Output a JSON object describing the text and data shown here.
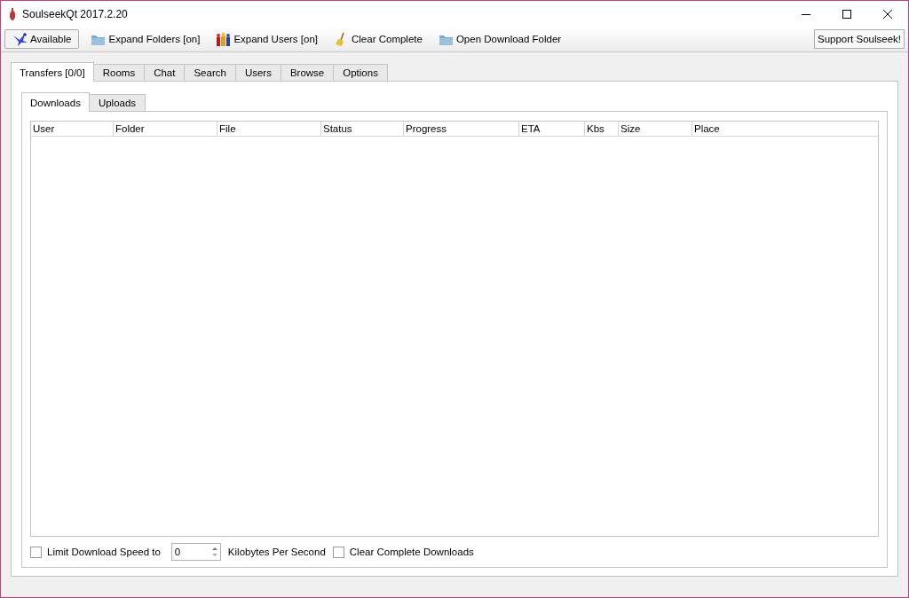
{
  "window": {
    "title": "SoulseekQt 2017.2.20"
  },
  "toolbar": {
    "buttons": [
      {
        "label": "Available",
        "kind": "status"
      },
      {
        "label": "Expand Folders [on]",
        "kind": "folder"
      },
      {
        "label": "Expand Users [on]",
        "kind": "users"
      },
      {
        "label": "Clear Complete",
        "kind": "broom"
      },
      {
        "label": "Open Download Folder",
        "kind": "folder"
      }
    ],
    "support_button": "Support Soulseek!"
  },
  "tabs": [
    {
      "label": "Transfers [0/0]",
      "selected": true
    },
    {
      "label": "Rooms",
      "selected": false
    },
    {
      "label": "Chat",
      "selected": false
    },
    {
      "label": "Search",
      "selected": false
    },
    {
      "label": "Users",
      "selected": false
    },
    {
      "label": "Browse",
      "selected": false
    },
    {
      "label": "Options",
      "selected": false
    }
  ],
  "subtabs": [
    {
      "label": "Downloads",
      "selected": true
    },
    {
      "label": "Uploads",
      "selected": false
    }
  ],
  "table": {
    "columns": [
      {
        "label": "User"
      },
      {
        "label": "Folder"
      },
      {
        "label": "File"
      },
      {
        "label": "Status"
      },
      {
        "label": "Progress"
      },
      {
        "label": "ETA"
      },
      {
        "label": "Kbs"
      },
      {
        "label": "Size"
      },
      {
        "label": "Place"
      }
    ]
  },
  "footer": {
    "limit_speed": {
      "label": "Limit Download Speed to",
      "checked": false
    },
    "speed": {
      "value": "0"
    },
    "unit": "Kilobytes Per Second",
    "clear_complete": {
      "label": "Clear Complete Downloads",
      "checked": false
    }
  }
}
